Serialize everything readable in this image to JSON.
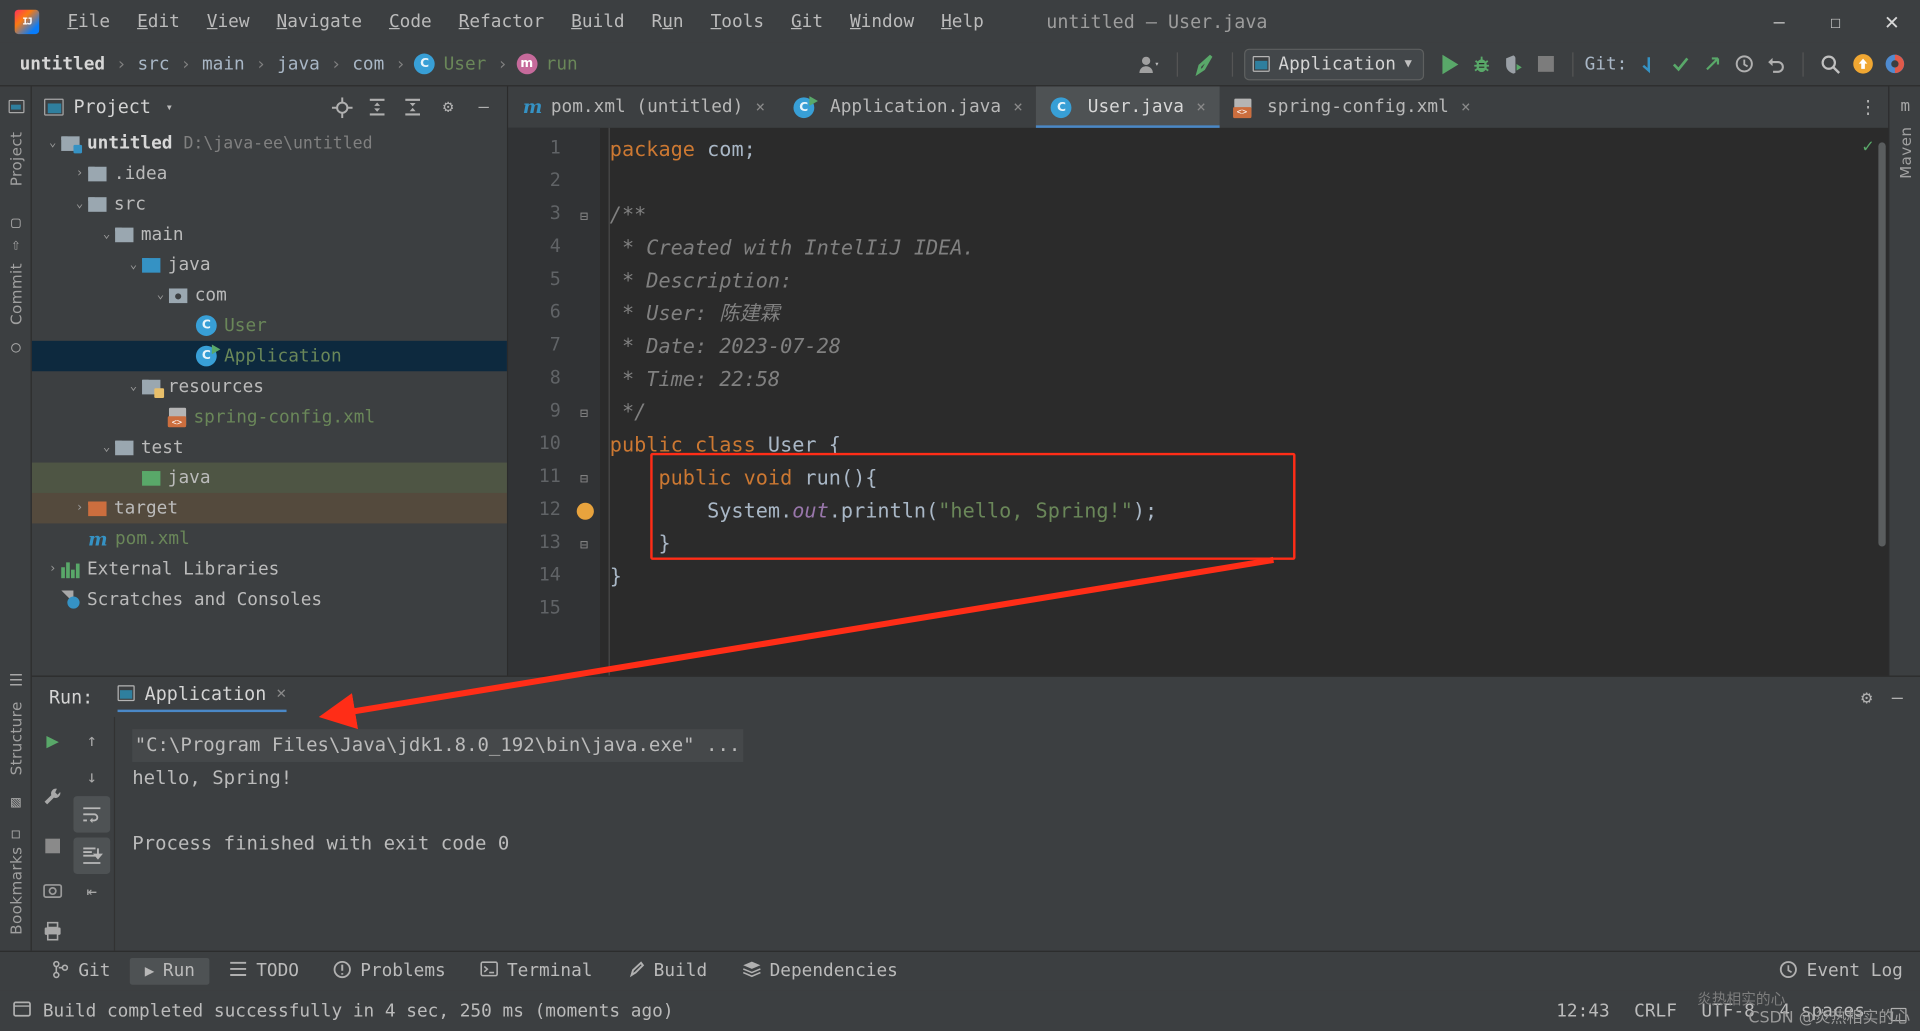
{
  "window": {
    "title": "untitled – User.java",
    "minimize_icon": "minimize-icon",
    "maximize_icon": "maximize-icon",
    "close_icon": "close-icon"
  },
  "menubar": {
    "logo": "intellij-idea-logo",
    "items": [
      {
        "label": "File",
        "mnemonic": "F"
      },
      {
        "label": "Edit",
        "mnemonic": "E"
      },
      {
        "label": "View",
        "mnemonic": "V"
      },
      {
        "label": "Navigate",
        "mnemonic": "N"
      },
      {
        "label": "Code",
        "mnemonic": "C"
      },
      {
        "label": "Refactor",
        "mnemonic": "R"
      },
      {
        "label": "Build",
        "mnemonic": "B"
      },
      {
        "label": "Run",
        "mnemonic": "u"
      },
      {
        "label": "Tools",
        "mnemonic": "T"
      },
      {
        "label": "Git",
        "mnemonic": "G"
      },
      {
        "label": "Window",
        "mnemonic": "W"
      },
      {
        "label": "Help",
        "mnemonic": "H"
      }
    ]
  },
  "navbar": {
    "crumbs": [
      {
        "label": "untitled",
        "kind": "root"
      },
      {
        "label": "src",
        "kind": "folder"
      },
      {
        "label": "main",
        "kind": "folder"
      },
      {
        "label": "java",
        "kind": "folder"
      },
      {
        "label": "com",
        "kind": "folder"
      },
      {
        "label": "User",
        "kind": "class"
      },
      {
        "label": "run",
        "kind": "method"
      }
    ],
    "separator": "›",
    "run_config": "Application",
    "git_label": "Git:",
    "icons": {
      "user_switch": "user-avatar-icon",
      "build_hammer": "hammer-build-icon",
      "run": "run-icon",
      "debug": "debug-bug-icon",
      "run_coverage": "run-with-coverage-icon",
      "stop": "stop-icon",
      "git_update": "git-update-icon",
      "git_commit": "git-commit-check-icon",
      "git_push": "git-push-arrow-icon",
      "history": "history-clock-icon",
      "undo": "undo-icon",
      "search": "search-icon",
      "updates": "updates-badge-icon",
      "settings": "settings-icon"
    }
  },
  "left_strip": {
    "project_tab": "Project",
    "commit_tab": "Commit",
    "structure_tab": "Structure",
    "bookmarks_tab": "Bookmarks",
    "more": "»"
  },
  "right_strip": {
    "maven_tab": "Maven"
  },
  "project_panel": {
    "title": "Project",
    "caret": "▾",
    "actions": [
      "locate-target-icon",
      "expand-all-icon",
      "collapse-all-icon",
      "gear-icon",
      "hide-panel-icon"
    ],
    "tree": [
      {
        "label": "untitled",
        "path": "D:\\java-ee\\untitled",
        "indent": 0,
        "arrow": "⌄",
        "icon": "project-folder",
        "style": "bold"
      },
      {
        "label": ".idea",
        "indent": 1,
        "arrow": "›",
        "icon": "folder-gray"
      },
      {
        "label": "src",
        "indent": 1,
        "arrow": "⌄",
        "icon": "folder-gray"
      },
      {
        "label": "main",
        "indent": 2,
        "arrow": "⌄",
        "icon": "folder-gray"
      },
      {
        "label": "java",
        "indent": 3,
        "arrow": "⌄",
        "icon": "folder-source-blue"
      },
      {
        "label": "com",
        "indent": 4,
        "arrow": "⌄",
        "icon": "folder-package"
      },
      {
        "label": "User",
        "indent": 5,
        "arrow": "",
        "icon": "java-class",
        "style": "green"
      },
      {
        "label": "Application",
        "indent": 5,
        "arrow": "",
        "icon": "java-class-runnable",
        "style": "green",
        "selected": true
      },
      {
        "label": "resources",
        "indent": 3,
        "arrow": "⌄",
        "icon": "folder-resources"
      },
      {
        "label": "spring-config.xml",
        "indent": 4,
        "arrow": "",
        "icon": "xml-file",
        "style": "green"
      },
      {
        "label": "test",
        "indent": 2,
        "arrow": "⌄",
        "icon": "folder-gray"
      },
      {
        "label": "java",
        "indent": 3,
        "arrow": "",
        "icon": "folder-test-green",
        "highlight": "green"
      },
      {
        "label": "target",
        "indent": 1,
        "arrow": "›",
        "icon": "folder-excluded-orange",
        "highlight": "brown"
      },
      {
        "label": "pom.xml",
        "indent": 1,
        "arrow": "",
        "icon": "maven-file",
        "style": "green"
      },
      {
        "label": "External Libraries",
        "indent": 0,
        "arrow": "›",
        "icon": "libraries-icon"
      },
      {
        "label": "Scratches and Consoles",
        "indent": 0,
        "arrow": "",
        "icon": "scratches-icon"
      }
    ]
  },
  "editor": {
    "tabs": [
      {
        "label": "pom.xml (untitled)",
        "icon": "maven-file-icon",
        "active": false
      },
      {
        "label": "Application.java",
        "icon": "java-class-runnable-icon",
        "active": false
      },
      {
        "label": "User.java",
        "icon": "java-class-icon",
        "active": true
      },
      {
        "label": "spring-config.xml",
        "icon": "xml-file-icon",
        "active": false
      }
    ],
    "tab_close": "×",
    "more_tabs_icon": "more-options-icon",
    "inspection_status": "✓",
    "lines": [
      {
        "no": 1,
        "tokens": [
          {
            "t": "package ",
            "c": "kw"
          },
          {
            "t": "com",
            "c": "cls"
          },
          {
            "t": ";",
            "c": ""
          }
        ]
      },
      {
        "no": 2,
        "tokens": []
      },
      {
        "no": 3,
        "tokens": [
          {
            "t": "/**",
            "c": "cm"
          }
        ],
        "fold": "⊟"
      },
      {
        "no": 4,
        "tokens": [
          {
            "t": " * Created with IntelIiJ IDEA.",
            "c": "cm"
          }
        ]
      },
      {
        "no": 5,
        "tokens": [
          {
            "t": " * Description:",
            "c": "cm"
          }
        ]
      },
      {
        "no": 6,
        "tokens": [
          {
            "t": " * User: 陈建霖",
            "c": "cm"
          }
        ]
      },
      {
        "no": 7,
        "tokens": [
          {
            "t": " * Date: 2023-07-28",
            "c": "cm"
          }
        ]
      },
      {
        "no": 8,
        "tokens": [
          {
            "t": " * Time: 22:58",
            "c": "cm"
          }
        ]
      },
      {
        "no": 9,
        "tokens": [
          {
            "t": " */",
            "c": "cm"
          }
        ],
        "fold": "⊟"
      },
      {
        "no": 10,
        "tokens": [
          {
            "t": "public class ",
            "c": "kw"
          },
          {
            "t": "User ",
            "c": "cls"
          },
          {
            "t": "{",
            "c": ""
          }
        ]
      },
      {
        "no": 11,
        "tokens": [
          {
            "t": "    public void ",
            "c": "kw"
          },
          {
            "t": "run",
            "c": "cls"
          },
          {
            "t": "(){",
            "c": ""
          }
        ],
        "fold": "⊟"
      },
      {
        "no": 12,
        "tokens": [
          {
            "t": "        System.",
            "c": "cls"
          },
          {
            "t": "out",
            "c": "fld"
          },
          {
            "t": ".println(",
            "c": "cls"
          },
          {
            "t": "\"hello, Spring!\"",
            "c": "str"
          },
          {
            "t": ");",
            "c": ""
          }
        ],
        "bulb": true
      },
      {
        "no": 13,
        "tokens": [
          {
            "t": "    }",
            "c": ""
          }
        ],
        "fold": "⊟"
      },
      {
        "no": 14,
        "tokens": [
          {
            "t": "}",
            "c": ""
          }
        ]
      },
      {
        "no": 15,
        "tokens": []
      }
    ]
  },
  "run_panel": {
    "label": "Run:",
    "tab": "Application",
    "tab_close": "×",
    "header_icons": [
      "settings-icon",
      "hide-panel-icon"
    ],
    "toolbar_icons": [
      "rerun-run-icon",
      "up-stacktrace-icon",
      "down-stacktrace-icon",
      "wrench-settings-icon",
      "soft-wrap-icon",
      "stop-icon",
      "scroll-to-end-icon",
      "print-icon",
      "camera-icon",
      "clear-all-icon",
      "trash-icon",
      "export-icon"
    ],
    "console_lines": [
      {
        "text": "\"C:\\Program Files\\Java\\jdk1.8.0_192\\bin\\java.exe\" ...",
        "style": "cmd"
      },
      {
        "text": "hello, Spring!",
        "style": "out"
      },
      {
        "text": "",
        "style": "out"
      },
      {
        "text": "Process finished with exit code 0",
        "style": "out"
      }
    ]
  },
  "bottom_bar": {
    "items": [
      {
        "label": "Git",
        "icon": "git-branch-icon",
        "active": false
      },
      {
        "label": "Run",
        "icon": "run-icon",
        "active": true
      },
      {
        "label": "TODO",
        "icon": "todo-list-icon",
        "active": false
      },
      {
        "label": "Problems",
        "icon": "problems-warning-icon",
        "active": false
      },
      {
        "label": "Terminal",
        "icon": "terminal-icon",
        "active": false
      },
      {
        "label": "Build",
        "icon": "build-hammer-icon",
        "active": false
      },
      {
        "label": "Dependencies",
        "icon": "dependencies-icon",
        "active": false
      }
    ],
    "event_log": "Event Log",
    "event_log_icon": "event-log-icon"
  },
  "status_bar": {
    "message": "Build completed successfully in 4 sec, 250 ms (moments ago)",
    "icon": "build-status-icon",
    "time": "12:43",
    "line_separator": "CRLF",
    "encoding": "UTF-8",
    "indent": "4 spaces",
    "lock_icon": "read-only-lock-icon"
  },
  "annotation": {
    "red_box_label": "highlight-box-run-method",
    "arrow_label": "red-arrow-pointing-to-output"
  },
  "watermark": {
    "text": "CSDN @炎热相实的心",
    "cn_text": "炎热相实的心"
  },
  "colors": {
    "background": "#3c3f41",
    "editor_bg": "#2b2b2b",
    "selection": "#0d293e",
    "accent_blue": "#4a88c7",
    "green": "#59a869",
    "red_annotation": "#ff2d17",
    "string_green": "#6a8759",
    "keyword_orange": "#cc7832"
  }
}
